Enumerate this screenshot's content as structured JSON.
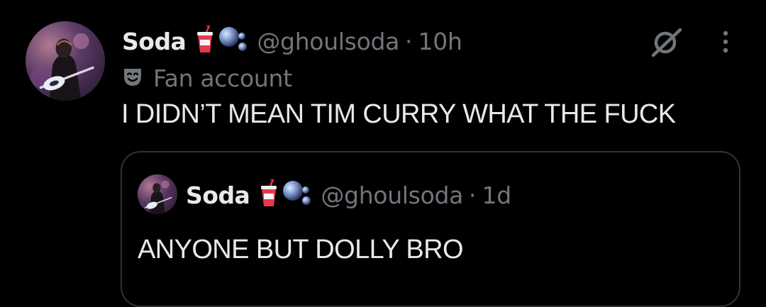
{
  "tweet": {
    "avatar": "avatar-photo-guitarist",
    "display_name": "Soda",
    "name_emojis": [
      "soda-cup-icon",
      "bubbles-icon"
    ],
    "handle": "@ghoulsoda",
    "separator": "·",
    "time": "10h",
    "label_icon": "theater-masks-icon",
    "label": "Fan account",
    "text": "I DIDN’T MEAN TIM CURRY WHAT THE FUCK",
    "actions": [
      "grok-icon",
      "more-options-icon"
    ]
  },
  "quoted_tweet": {
    "avatar": "avatar-photo-guitarist",
    "display_name": "Soda",
    "name_emojis": [
      "soda-cup-icon",
      "bubbles-icon"
    ],
    "handle": "@ghoulsoda",
    "separator": "·",
    "time": "1d",
    "text": "ANYONE BUT DOLLY BRO"
  },
  "colors": {
    "background": "#000000",
    "primary_text": "#e7e9ea",
    "secondary_text": "#71767b",
    "border": "#2f3336",
    "cup_red": "#e8374b"
  }
}
